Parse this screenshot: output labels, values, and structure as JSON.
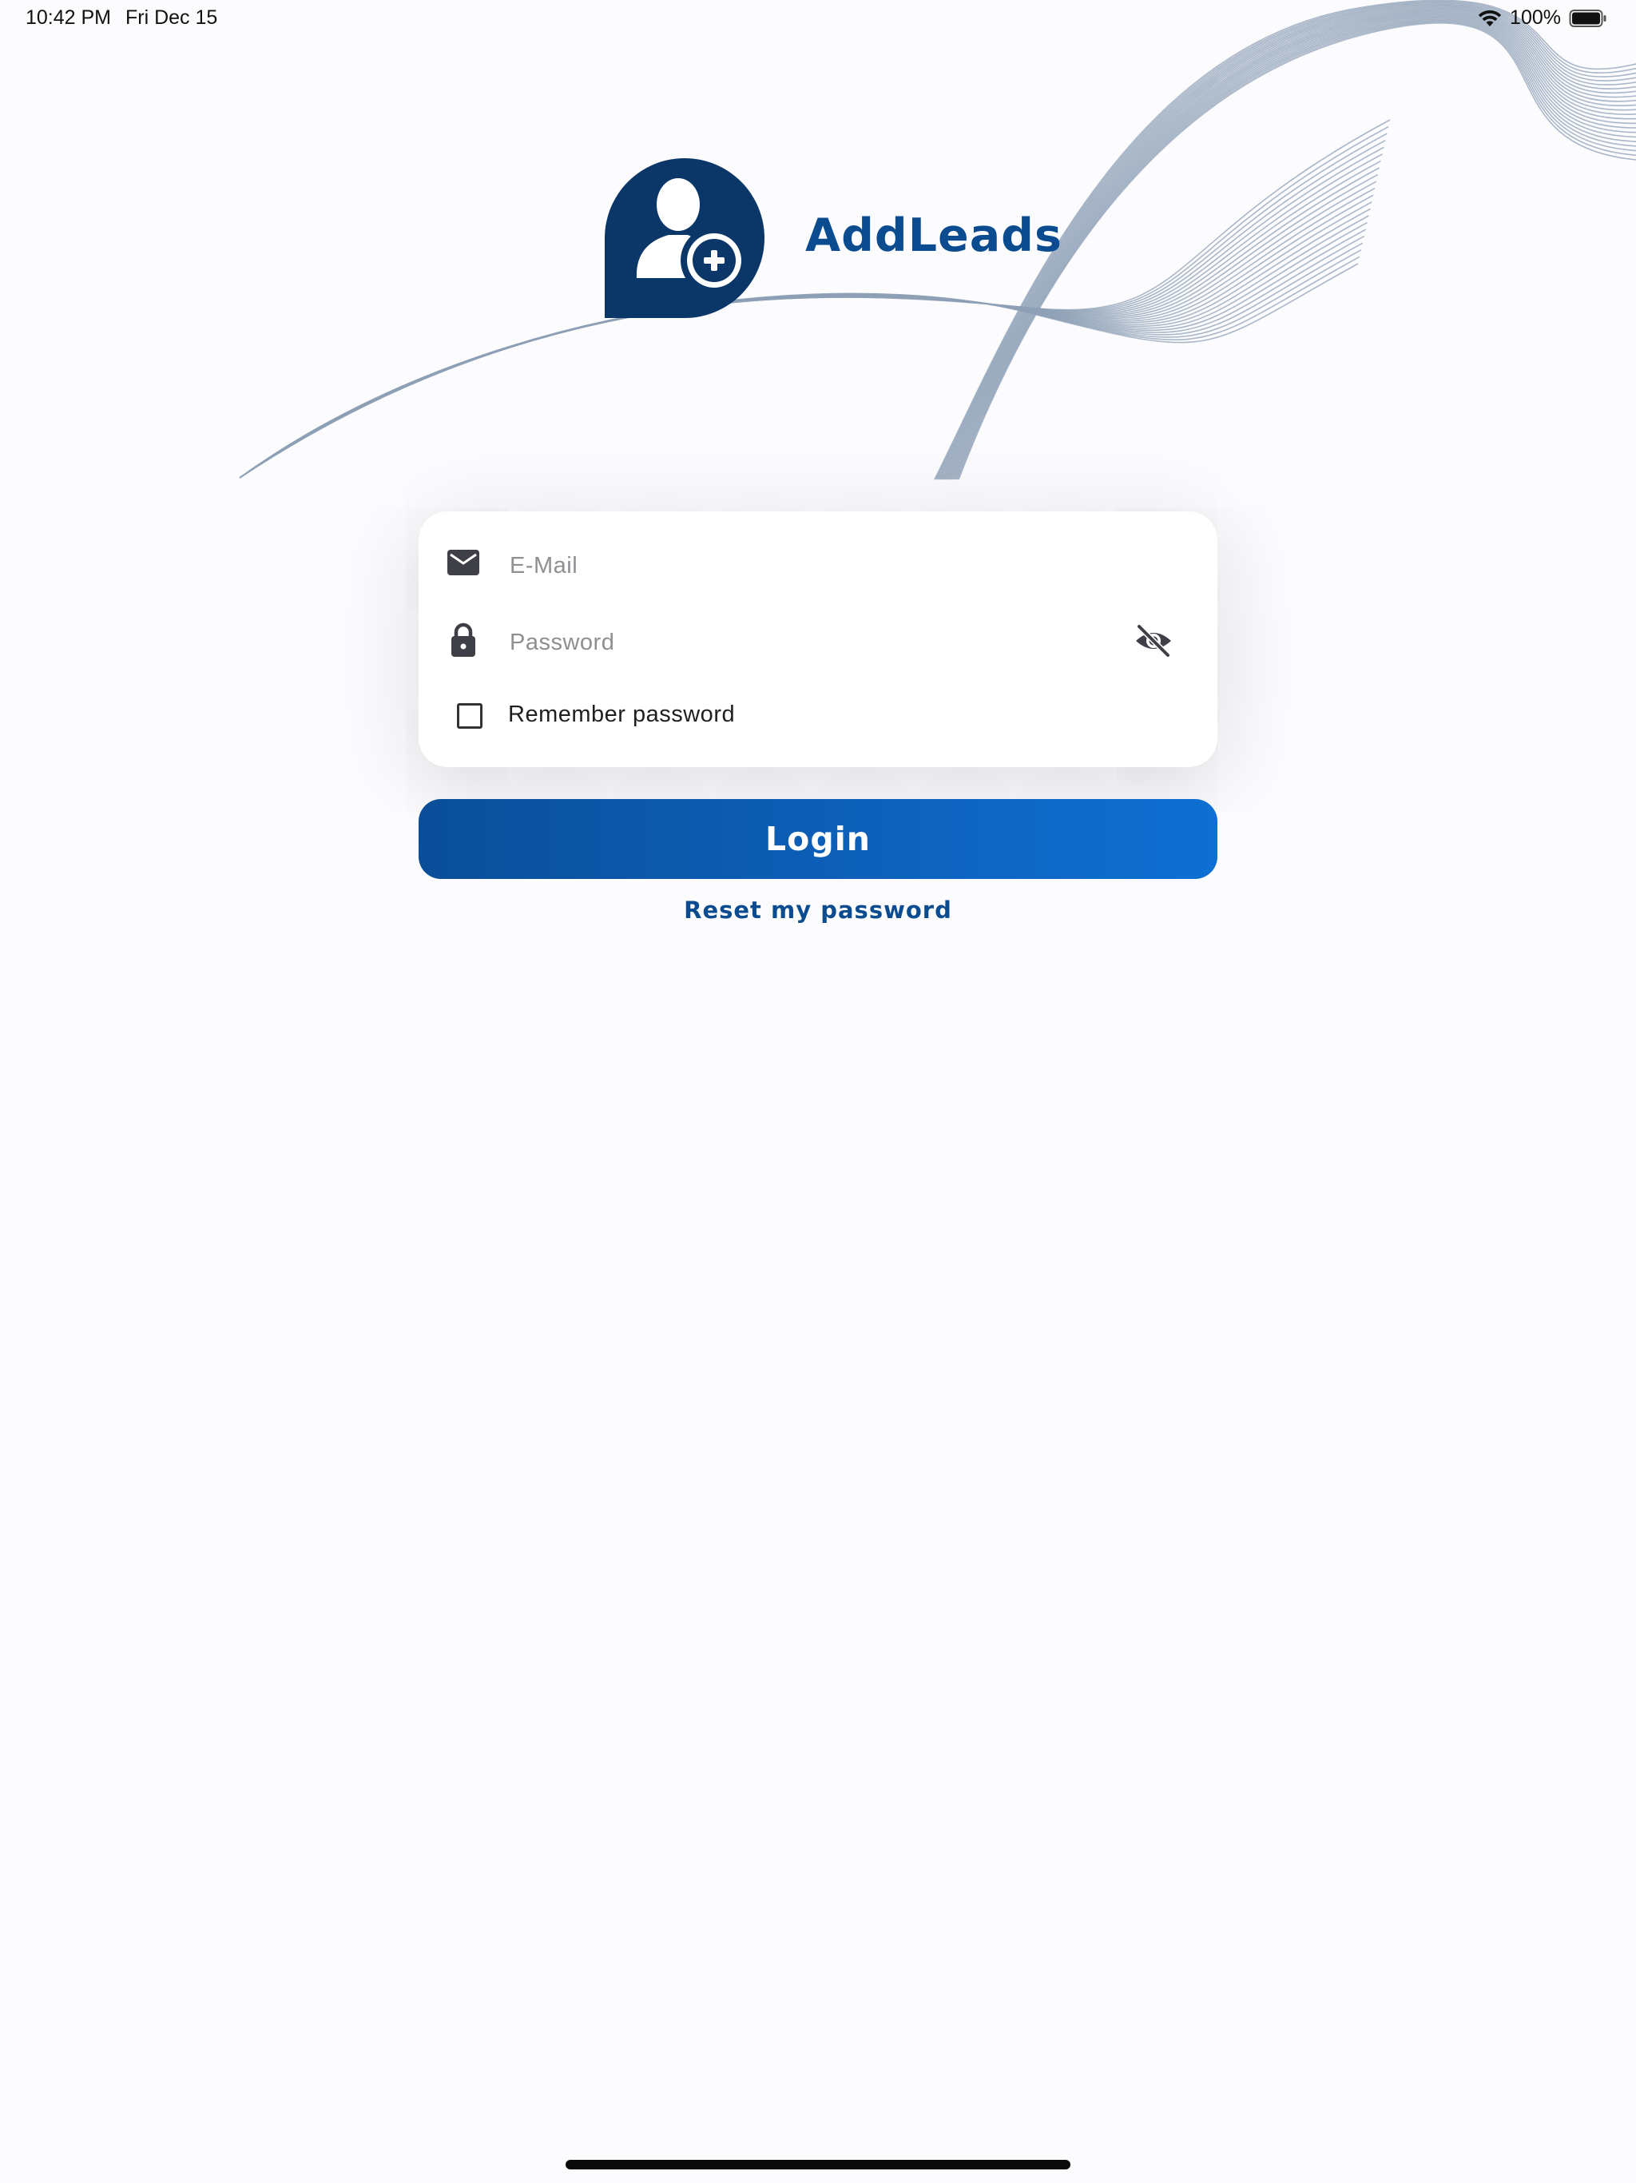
{
  "status_bar": {
    "time": "10:42 PM",
    "date": "Fri Dec 15",
    "battery_percent": "100%",
    "icons": [
      "wifi-icon",
      "battery-icon"
    ]
  },
  "app": {
    "brand_name": "AddLeads",
    "logo_icon": "add-user-logo-icon"
  },
  "form": {
    "email_placeholder": "E-Mail",
    "email_value": "",
    "email_icon": "envelope-icon",
    "password_placeholder": "Password",
    "password_value": "",
    "password_icon": "lock-icon",
    "password_toggle_icon": "eye-off-icon",
    "remember_label": "Remember password",
    "remember_checked": false
  },
  "actions": {
    "login_label": "Login",
    "reset_label": "Reset my password"
  },
  "colors": {
    "brand": "#0a4c8f",
    "button_start": "#0a4e99",
    "button_end": "#0f6fd3",
    "background": "#fcfbfe",
    "wave": "#8da0b6"
  }
}
